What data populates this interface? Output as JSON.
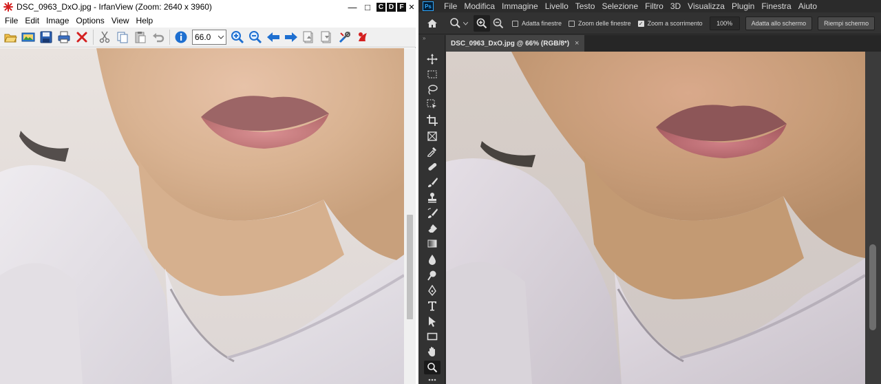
{
  "irfanview": {
    "title": "DSC_0963_DxO.jpg - IrfanView (Zoom: 2640 x 3960)",
    "caption": {
      "minimize": "—",
      "maximize": "□",
      "close": "✕",
      "cdf": [
        "C",
        "D",
        "F"
      ]
    },
    "menu": [
      "File",
      "Edit",
      "Image",
      "Options",
      "View",
      "Help"
    ],
    "zoom_value": "66.0",
    "toolbar_icons": [
      "open-icon",
      "slideshow-icon",
      "save-icon",
      "print-icon",
      "delete-icon",
      "cut-icon",
      "copy-icon",
      "paste-icon",
      "undo-icon",
      "info-icon",
      "zoom-in-icon",
      "zoom-out-icon",
      "previous-icon",
      "next-icon",
      "first-page-icon",
      "last-page-icon",
      "settings-icon",
      "irfanview-logo-icon"
    ]
  },
  "photoshop": {
    "menu": [
      "File",
      "Modifica",
      "Immagine",
      "Livello",
      "Testo",
      "Selezione",
      "Filtro",
      "3D",
      "Visualizza",
      "Plugin",
      "Finestra",
      "Aiuto"
    ],
    "options": {
      "adatta_finestre": "Adatta finestre",
      "zoom_finestre": "Zoom delle finestre",
      "zoom_scorrimento": "Zoom a scorrimento",
      "zoom_percent": "100%",
      "adatta_schermo": "Adatta allo schermo",
      "riempi_schermo": "Riempi schermo"
    },
    "options_checked": {
      "adatta_finestre": false,
      "zoom_finestre": false,
      "zoom_scorrimento": true
    },
    "tab_label": "DSC_0963_DxO.jpg @ 66% (RGB/8*)",
    "tab_close": "×",
    "tools": [
      "move-tool-icon",
      "marquee-tool-icon",
      "lasso-tool-icon",
      "object-select-tool-icon",
      "crop-tool-icon",
      "frame-tool-icon",
      "eyedropper-tool-icon",
      "healing-brush-icon",
      "brush-tool-icon",
      "clone-stamp-icon",
      "history-brush-icon",
      "eraser-tool-icon",
      "gradient-tool-icon",
      "blur-tool-icon",
      "dodge-tool-icon",
      "pen-tool-icon",
      "type-tool-icon",
      "path-select-icon",
      "rectangle-tool-icon",
      "hand-tool-icon",
      "zoom-tool-icon"
    ],
    "active_tool": "zoom-tool-icon"
  },
  "colors": {
    "ps_accent": "#31a8ff",
    "iv_blue": "#1e6fd0",
    "iv_red": "#d42020"
  }
}
